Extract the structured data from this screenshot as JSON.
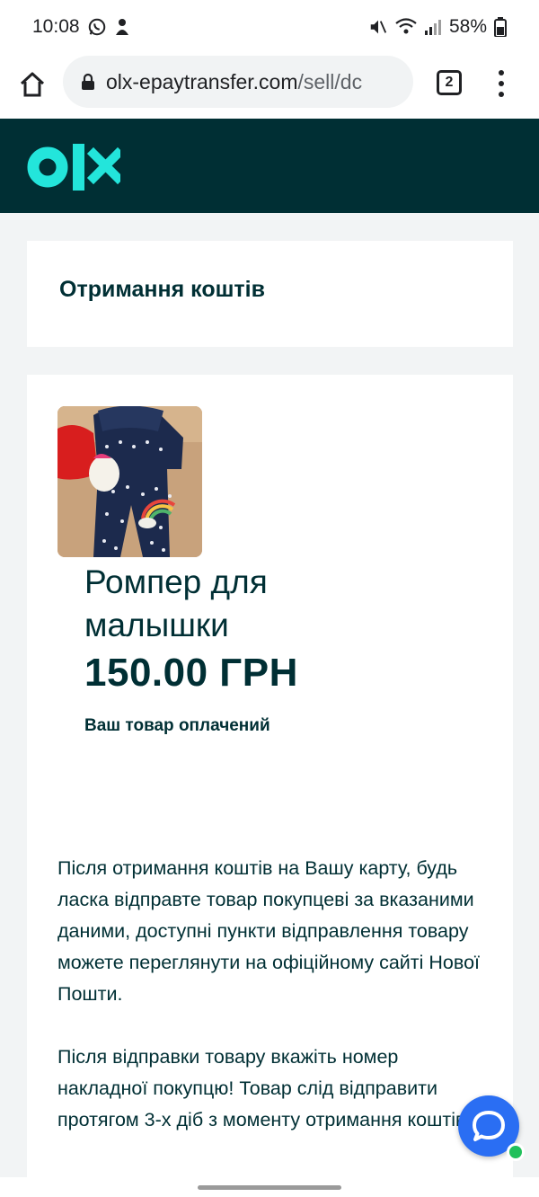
{
  "status_bar": {
    "time": "10:08",
    "battery": "58%",
    "icons": [
      "whatsapp-icon",
      "notification-icon",
      "mute-icon",
      "wifi-icon",
      "signal-icon",
      "battery-icon"
    ]
  },
  "browser": {
    "url_domain": "olx-epaytransfer.com",
    "url_path": "/sell/dc",
    "tab_count": "2"
  },
  "brand": {
    "logo_text": "olx",
    "header_color": "#002f34",
    "accent_color": "#23e5db"
  },
  "page": {
    "section_title": "Отримання коштів",
    "product": {
      "name": "Ромпер для малышки",
      "price": "150.00 ГРН",
      "status": "Ваш товар оплачений"
    },
    "info_paragraph_1": "Після отримання коштів на Вашу карту, будь ласка відправте товар покупцеві за вказаними даними, доступні пункти відправлення товару можете переглянути на офіційному сайті Нової Пошти.",
    "info_paragraph_2": "Після відправки товару вкажіть номер накладної покупцю! Товар слід відправити протягом 3-х діб з моменту отримання коштів"
  },
  "chat": {
    "button_color": "#2a6ef3",
    "online_color": "#21c05b"
  }
}
